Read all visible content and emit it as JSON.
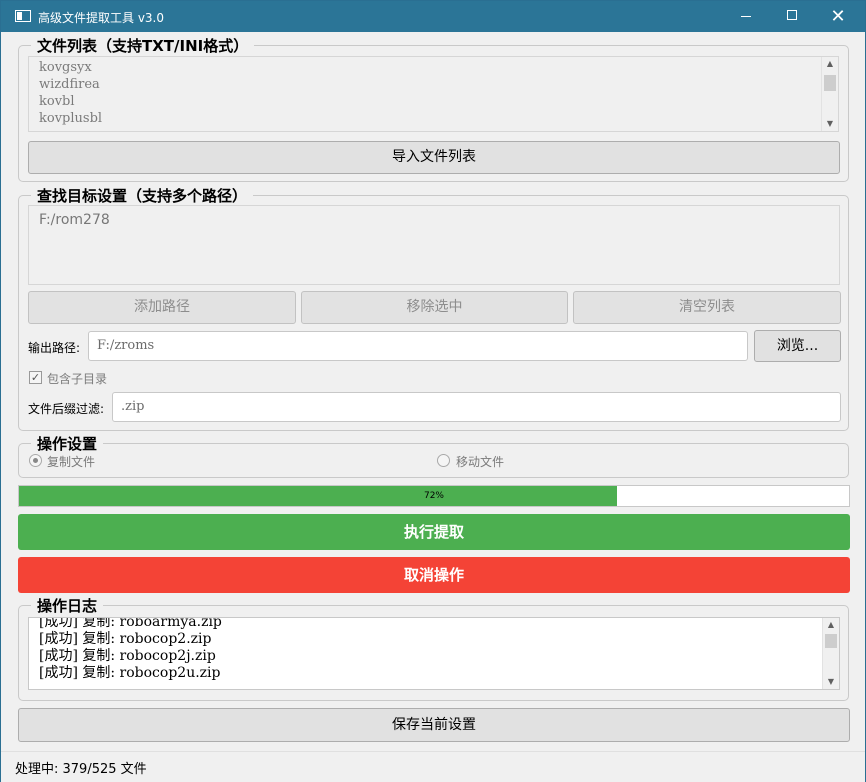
{
  "window": {
    "title": "高级文件提取工具 v3.0",
    "controls": {
      "minimize": "—",
      "maximize": "",
      "close": "✕"
    }
  },
  "file_list": {
    "title": "文件列表（支持TXT/INI格式）",
    "items": [
      "kovgsyx",
      "wizdfirea",
      "kovbl",
      "kovplusbl"
    ],
    "import_button": "导入文件列表"
  },
  "target": {
    "title": "查找目标设置（支持多个路径）",
    "paths": [
      "F:/rom278"
    ],
    "add_button": "添加路径",
    "remove_button": "移除选中",
    "clear_button": "清空列表",
    "output_label": "输出路径:",
    "output_value": "F:/zroms",
    "browse_button": "浏览...",
    "include_subdirs_label": "包含子目录",
    "include_subdirs_checked": true,
    "suffix_label": "文件后缀过滤:",
    "suffix_value": ".zip"
  },
  "operation": {
    "title": "操作设置",
    "copy_label": "复制文件",
    "move_label": "移动文件",
    "selected": "copy"
  },
  "progress": {
    "value": 72,
    "text": "72%",
    "color": "#4caf50"
  },
  "actions": {
    "execute_label": "执行提取",
    "execute_color": "#4caf50",
    "cancel_label": "取消操作",
    "cancel_color": "#f44336"
  },
  "log": {
    "title": "操作日志",
    "lines": [
      "[成功] 复制: roboarmya.zip",
      "[成功] 复制: robocop2.zip",
      "[成功] 复制: robocop2j.zip",
      "[成功] 复制: robocop2u.zip"
    ]
  },
  "save_button": "保存当前设置",
  "status": "处理中: 379/525 文件"
}
